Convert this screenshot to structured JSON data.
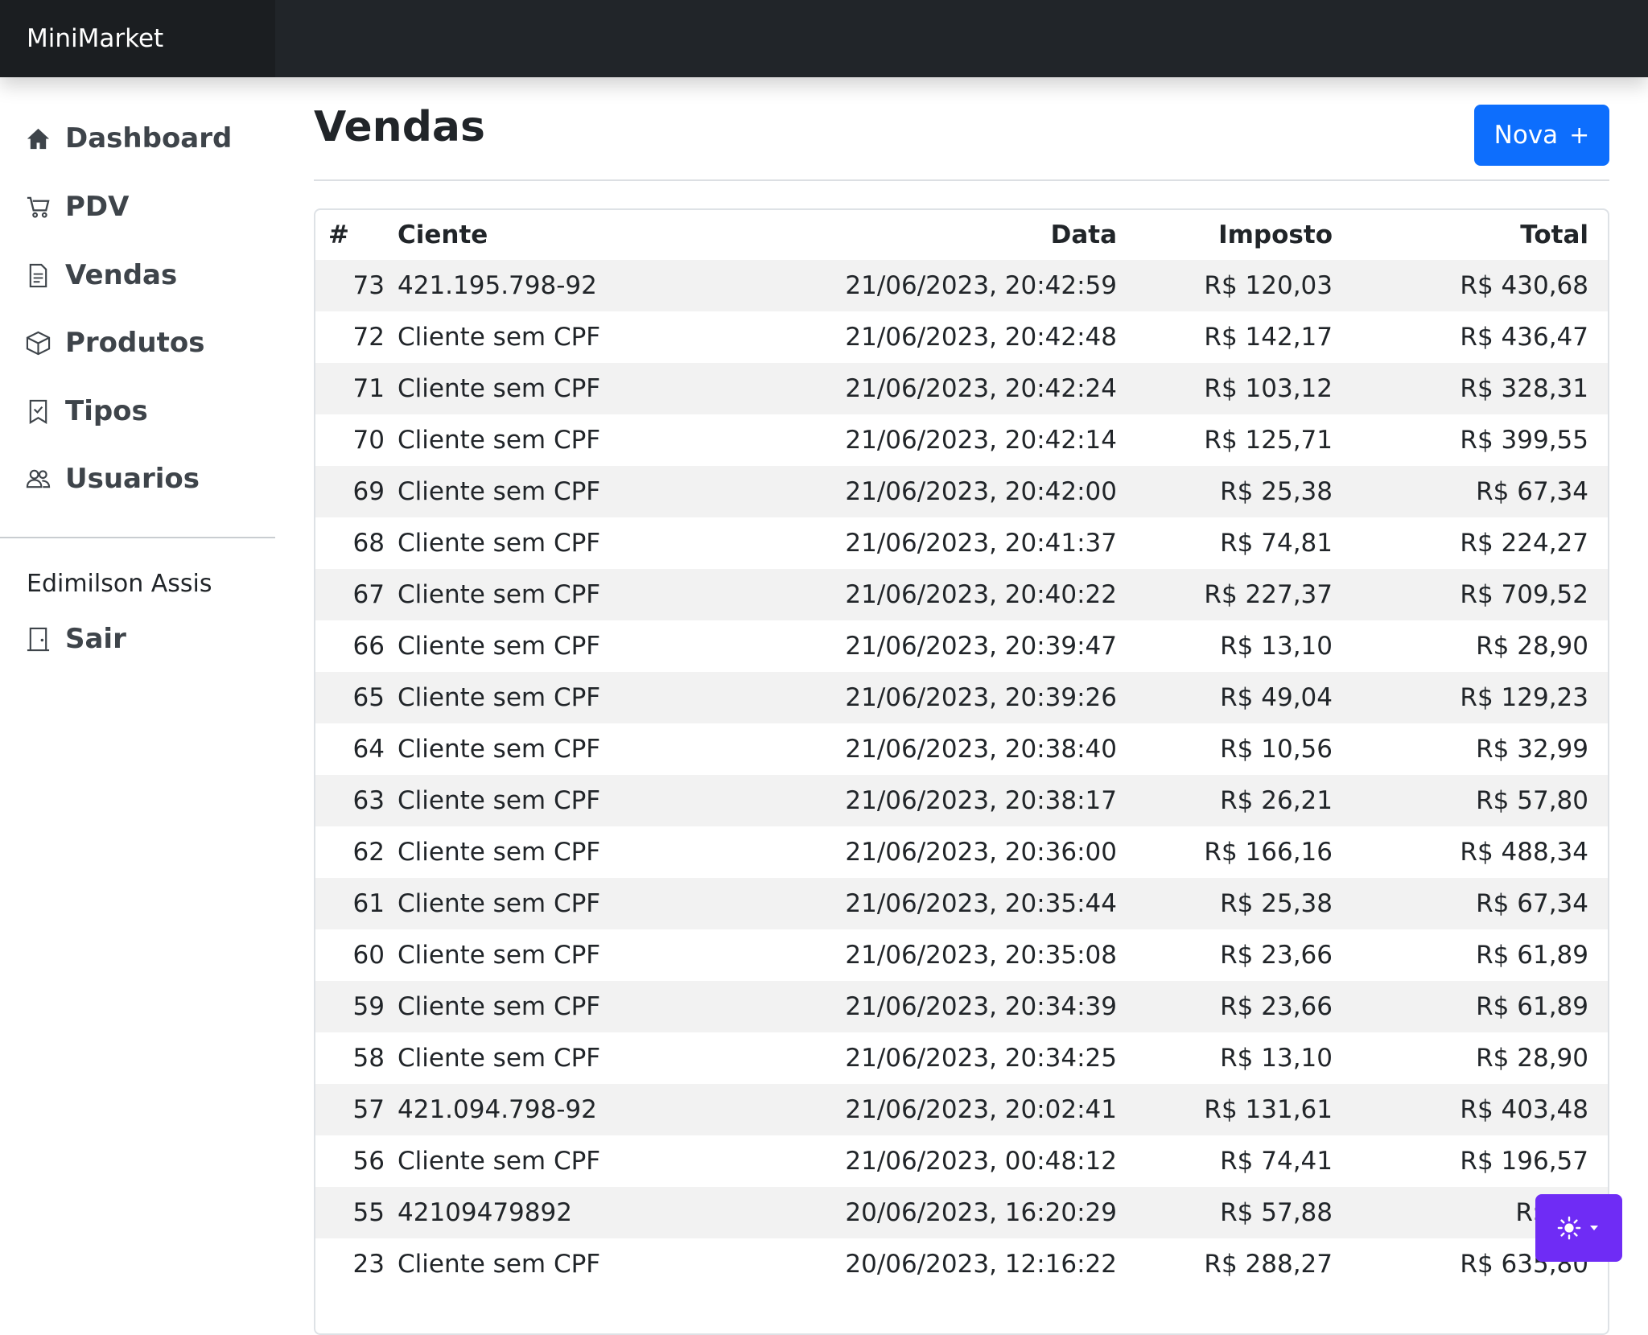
{
  "brand": "MiniMarket",
  "sidebar": {
    "items": [
      {
        "label": "Dashboard",
        "icon": "house-icon"
      },
      {
        "label": "PDV",
        "icon": "cart-icon"
      },
      {
        "label": "Vendas",
        "icon": "receipt-icon"
      },
      {
        "label": "Produtos",
        "icon": "box-icon"
      },
      {
        "label": "Tipos",
        "icon": "bookmark-check-icon"
      },
      {
        "label": "Usuarios",
        "icon": "people-icon"
      }
    ],
    "user_name": "Edimilson Assis",
    "logout_label": "Sair",
    "logout_icon": "door-icon"
  },
  "main": {
    "title": "Vendas",
    "new_button": {
      "label": "Nova",
      "icon": "plus-icon"
    },
    "columns": [
      "#",
      "Ciente",
      "Data",
      "Imposto",
      "Total"
    ],
    "rows": [
      [
        "73",
        "421.195.798-92",
        "21/06/2023, 20:42:59",
        "R$ 120,03",
        "R$ 430,68"
      ],
      [
        "72",
        "Cliente sem CPF",
        "21/06/2023, 20:42:48",
        "R$ 142,17",
        "R$ 436,47"
      ],
      [
        "71",
        "Cliente sem CPF",
        "21/06/2023, 20:42:24",
        "R$ 103,12",
        "R$ 328,31"
      ],
      [
        "70",
        "Cliente sem CPF",
        "21/06/2023, 20:42:14",
        "R$ 125,71",
        "R$ 399,55"
      ],
      [
        "69",
        "Cliente sem CPF",
        "21/06/2023, 20:42:00",
        "R$ 25,38",
        "R$ 67,34"
      ],
      [
        "68",
        "Cliente sem CPF",
        "21/06/2023, 20:41:37",
        "R$ 74,81",
        "R$ 224,27"
      ],
      [
        "67",
        "Cliente sem CPF",
        "21/06/2023, 20:40:22",
        "R$ 227,37",
        "R$ 709,52"
      ],
      [
        "66",
        "Cliente sem CPF",
        "21/06/2023, 20:39:47",
        "R$ 13,10",
        "R$ 28,90"
      ],
      [
        "65",
        "Cliente sem CPF",
        "21/06/2023, 20:39:26",
        "R$ 49,04",
        "R$ 129,23"
      ],
      [
        "64",
        "Cliente sem CPF",
        "21/06/2023, 20:38:40",
        "R$ 10,56",
        "R$ 32,99"
      ],
      [
        "63",
        "Cliente sem CPF",
        "21/06/2023, 20:38:17",
        "R$ 26,21",
        "R$ 57,80"
      ],
      [
        "62",
        "Cliente sem CPF",
        "21/06/2023, 20:36:00",
        "R$ 166,16",
        "R$ 488,34"
      ],
      [
        "61",
        "Cliente sem CPF",
        "21/06/2023, 20:35:44",
        "R$ 25,38",
        "R$ 67,34"
      ],
      [
        "60",
        "Cliente sem CPF",
        "21/06/2023, 20:35:08",
        "R$ 23,66",
        "R$ 61,89"
      ],
      [
        "59",
        "Cliente sem CPF",
        "21/06/2023, 20:34:39",
        "R$ 23,66",
        "R$ 61,89"
      ],
      [
        "58",
        "Cliente sem CPF",
        "21/06/2023, 20:34:25",
        "R$ 13,10",
        "R$ 28,90"
      ],
      [
        "57",
        "421.094.798-92",
        "21/06/2023, 20:02:41",
        "R$ 131,61",
        "R$ 403,48"
      ],
      [
        "56",
        "Cliente sem CPF",
        "21/06/2023, 00:48:12",
        "R$ 74,41",
        "R$ 196,57"
      ],
      [
        "55",
        "42109479892",
        "20/06/2023, 16:20:29",
        "R$ 57,88",
        "R$ 15"
      ],
      [
        "23",
        "Cliente sem CPF",
        "20/06/2023, 12:16:22",
        "R$ 288,27",
        "R$ 635,80"
      ]
    ]
  },
  "theme_toggle": {
    "icon": "sun-icon",
    "caret_icon": "caret-down-icon",
    "color": "#6f2cf5"
  },
  "colors": {
    "topbar": "#212529",
    "primary": "#0d6efd",
    "stripe": "#f2f2f2"
  }
}
